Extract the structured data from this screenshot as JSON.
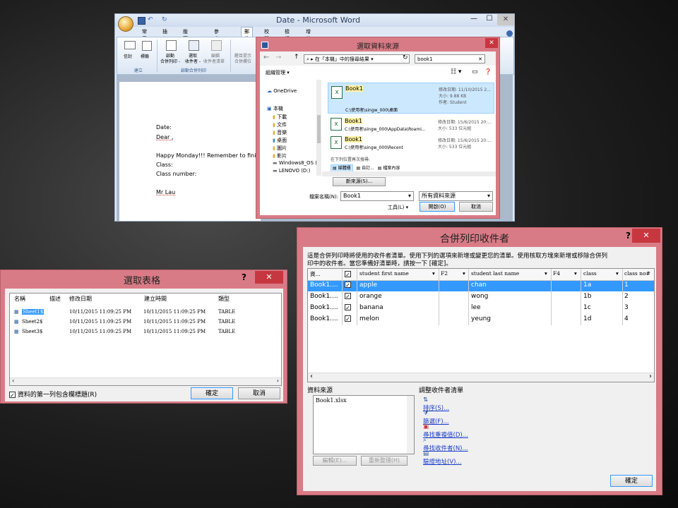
{
  "word": {
    "title": "Date - Microsoft Word",
    "tabs": [
      "常用",
      "插入",
      "版面配置",
      "參考資料",
      "郵件",
      "校閱",
      "檢視",
      "增益集"
    ],
    "ribbon": {
      "envelope": "信封",
      "labels": "標籤",
      "group1": "建立",
      "start": "啟動",
      "start2": "合併列印 -",
      "select": "選取",
      "select2": "收件者 -",
      "edit": "編輯",
      "edit2": "收件者清單",
      "highlight": "醒目提示",
      "highlight2": "合併欄位",
      "group2": "啟動合併列印"
    },
    "doc_lines": [
      "Date:",
      "Dear ,",
      "",
      "Happy Monday!!! Remember to finish y",
      "Class:",
      "Class number:",
      "",
      "Mr Lau"
    ]
  },
  "select_source": {
    "title": "選取資料來源",
    "breadcrumb": "在「本機」中的搜尋結果",
    "search": "book1",
    "organize": "組織管理",
    "tree": [
      "OneDrive",
      "本機",
      "下載",
      "文件",
      "音樂",
      "桌面",
      "圖片",
      "影片",
      "Windows8_OS (",
      "LENOVO (D:)"
    ],
    "files": [
      {
        "name": "Book1",
        "path": "C:\\使用者\\singw_000\\桌面",
        "meta1": "修改日期: 11/10/2015 2...",
        "meta2": "大小: 9.88 KB",
        "meta3": "作者: Student"
      },
      {
        "name": "Book1",
        "path": "C:\\使用者\\singw_000\\AppData\\Roami...",
        "meta1": "修改日期: 15/6/2015 20:...",
        "meta2": "大小: 533 位元組",
        "meta3": ""
      },
      {
        "name": "Book1",
        "path": "C:\\使用者\\singw_000\\Recent",
        "meta1": "修改日期: 15/6/2015 20:...",
        "meta2": "大小: 533 位元組",
        "meta3": ""
      }
    ],
    "search_again": "在下列位置再次搜尋:",
    "search_locs": [
      "媒體櫃",
      "自訂...",
      "檔案內容"
    ],
    "new_source": "新來源(S)...",
    "filename_label": "檔案名稱(N):",
    "filename_value": "Book1",
    "filetype_value": "所有資料來源",
    "tools": "工具(L)",
    "open": "開啟(O)",
    "cancel": "取消"
  },
  "select_table": {
    "title": "選取表格",
    "help": "?",
    "columns": [
      "名稱",
      "描述",
      "修改日期",
      "建立時間",
      "類型"
    ],
    "rows": [
      {
        "name": "Sheet1$",
        "desc": "",
        "modified": "10/11/2015 11:09:25 PM",
        "created": "10/11/2015 11:09:25 PM",
        "type": "TABLE"
      },
      {
        "name": "Sheet2$",
        "desc": "",
        "modified": "10/11/2015 11:09:25 PM",
        "created": "10/11/2015 11:09:25 PM",
        "type": "TABLE"
      },
      {
        "name": "Sheet3$",
        "desc": "",
        "modified": "10/11/2015 11:09:25 PM",
        "created": "10/11/2015 11:09:25 PM",
        "type": "TABLE"
      }
    ],
    "checkbox_label": "資料的第一列包含欄標題(R)",
    "ok": "確定",
    "cancel": "取消"
  },
  "recipients": {
    "title": "合併列印收件者",
    "help": "?",
    "desc1": "這是合併列印時將使用的收件者清單。使用下列的選項來新增或變更您的清單。使用核取方塊來新增或移除合併列",
    "desc2": "印中的收件者。當您準備好清單時，請按一下 [確定]。",
    "columns": [
      "資...",
      "",
      "student first name",
      "F2",
      "student last name",
      "F4",
      "class",
      "class no#"
    ],
    "rows": [
      {
        "src": "Book1....",
        "first": "apple",
        "f2": "",
        "last": "chan",
        "f4": "",
        "class": "1a",
        "no": "1"
      },
      {
        "src": "Book1....",
        "first": "orange",
        "f2": "",
        "last": "wong",
        "f4": "",
        "class": "1b",
        "no": "2"
      },
      {
        "src": "Book1....",
        "first": "banana",
        "f2": "",
        "last": "lee",
        "f4": "",
        "class": "1c",
        "no": "3"
      },
      {
        "src": "Book1....",
        "first": "melon",
        "f2": "",
        "last": "yeung",
        "f4": "",
        "class": "1d",
        "no": "4"
      }
    ],
    "data_source_label": "資料來源",
    "data_source_item": "Book1.xlsx",
    "edit": "編輯(E)...",
    "refresh": "重新整理(H)",
    "adjust_label": "調整收件者清單",
    "links": [
      "排序(S)...",
      "篩選(F)...",
      "尋找重複值(D)...",
      "尋找收件者(N)...",
      "驗證地址(V)..."
    ],
    "ok": "確定"
  },
  "colors": {
    "frame": "#d97b86",
    "selection": "#cce8ff",
    "accent_blue": "#3399ff",
    "close_red": "#c7373f"
  }
}
